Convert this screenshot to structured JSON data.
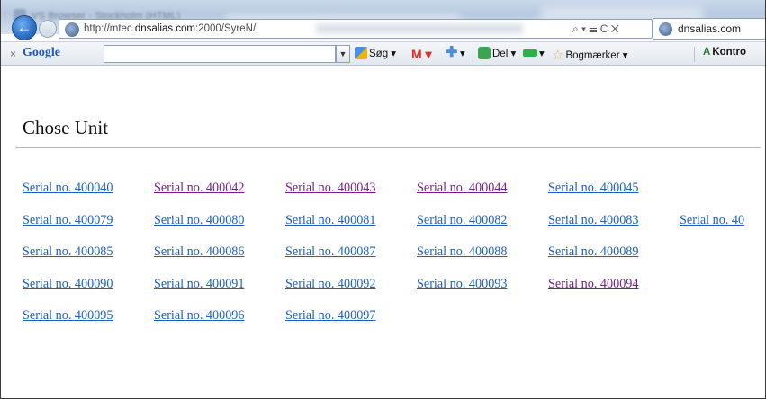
{
  "browser": {
    "title": "VS Browser - Stockholm (HTML)",
    "address_url_prefix": "http://mtec.",
    "address_url_host": "dnsalias.com",
    "address_url_suffix": ":2000/SyreN/",
    "address_tools": "⌕ ▾ ☰ C ✕",
    "tab_label": "dnsalias.com"
  },
  "google_toolbar": {
    "close": "×",
    "logo": "Google",
    "search_value": "",
    "items": {
      "search": "Søg ▾",
      "gmail": "M ▾",
      "plus": "▾",
      "share": "Del ▾",
      "bar": "▾",
      "bookmarks": "Bogmærker ▾",
      "kontrol": "Kontro"
    }
  },
  "page": {
    "title": "Chose Unit",
    "rows": [
      [
        {
          "label": "Serial no. 400040",
          "visited": false
        },
        {
          "label": "Serial no. 400042",
          "visited": true
        },
        {
          "label": "Serial no. 400043",
          "visited": true
        },
        {
          "label": "Serial no. 400044",
          "visited": true
        },
        {
          "label": "Serial no. 400045",
          "visited": false
        }
      ],
      [
        {
          "label": "Serial no. 400079",
          "visited": false
        },
        {
          "label": "Serial no. 400080",
          "visited": false
        },
        {
          "label": "Serial no. 400081",
          "visited": false
        },
        {
          "label": "Serial no. 400082",
          "visited": false
        },
        {
          "label": "Serial no. 400083",
          "visited": false
        },
        {
          "label": "Serial no. 40",
          "visited": false
        }
      ],
      [
        {
          "label": "Serial no. 400085",
          "visited": false
        },
        {
          "label": "Serial no. 400086",
          "visited": false
        },
        {
          "label": "Serial no. 400087",
          "visited": false
        },
        {
          "label": "Serial no. 400088",
          "visited": false
        },
        {
          "label": "Serial no. 400089",
          "visited": false
        }
      ],
      [
        {
          "label": "Serial no. 400090",
          "visited": false
        },
        {
          "label": "Serial no. 400091",
          "visited": false
        },
        {
          "label": "Serial no. 400092",
          "visited": false
        },
        {
          "label": "Serial no. 400093",
          "visited": false
        },
        {
          "label": "Serial no. 400094",
          "visited": true
        }
      ],
      [
        {
          "label": "Serial no. 400095",
          "visited": false
        },
        {
          "label": "Serial no. 400096",
          "visited": false
        },
        {
          "label": "Serial no. 400097",
          "visited": false
        }
      ]
    ]
  },
  "colors": {
    "link": "#1b5fc9",
    "visited_link": "#7a1e8c"
  }
}
